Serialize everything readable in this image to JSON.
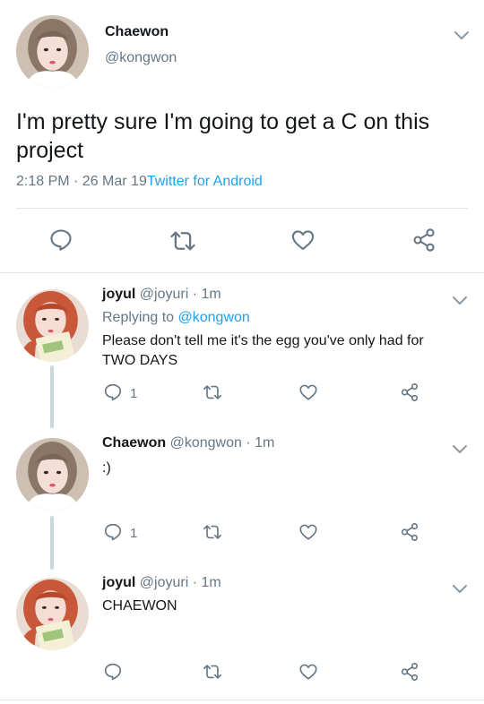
{
  "main_tweet": {
    "display_name": "Chaewon",
    "handle": "@kongwon",
    "text_line1": "I'm pretty sure I'm going to get a C on this",
    "text_line2": "project",
    "time": "2:18 PM · 26 Mar 19",
    "source": "Twitter for Android"
  },
  "replies": [
    {
      "display_name": "joyul",
      "handle": "@joyuri",
      "time": "· 1m",
      "replying_prefix": "Replying to",
      "replying_handle": "@kongwon",
      "text_line1": "Please don't tell me it's the egg you've only had for",
      "text_line2": "TWO DAYS",
      "reply_count": "1"
    },
    {
      "display_name": "Chaewon",
      "handle": "@kongwon",
      "time": "· 1m",
      "text_line1": ":)",
      "reply_count": "1"
    },
    {
      "display_name": "joyul",
      "handle": "@joyuri",
      "time": "· 1m",
      "text_line1": "CHAEWON"
    }
  ],
  "colors": {
    "accent": "#1da1f2",
    "text": "#14171a",
    "muted": "#657786",
    "divider": "#e1e8ed",
    "thread_line": "#ccd6dd"
  },
  "icons": [
    "chevron-down-icon",
    "reply-icon",
    "retweet-icon",
    "like-icon",
    "share-icon"
  ]
}
